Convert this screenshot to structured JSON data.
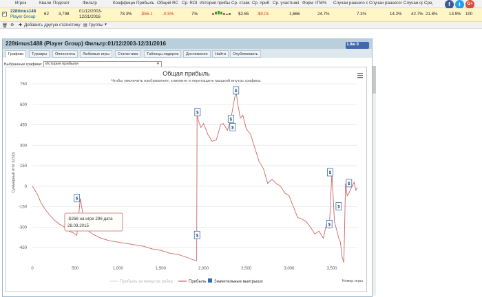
{
  "table": {
    "headers": [
      "Игрок",
      "Квали",
      "Подсчет",
      "Фильтр",
      "Коэффициен",
      "Прибыль",
      "Общий RC",
      "Ср. ROI",
      "История прибы",
      "Ср. ставк",
      "Ср. приб",
      "Ср. участникі",
      "Форм",
      "ITM%",
      "Случаи раннего с",
      "Случаи раннего/сре",
      "Случаи ср",
      "Средн"
    ],
    "row": {
      "player_name": "228timus148",
      "player_group": "Player Group",
      "qual": "62",
      "count": "3,798",
      "filter": "01/12/2003-\n12/31/2016",
      "coef": "78.3%",
      "profit": "-$55.1",
      "total_rc": "-0.5%",
      "avg_roi": "7%",
      "avg_stake": "$2.65",
      "avg_profit": "-$0.01",
      "avg_participants": "1,666",
      "itm": "24.7%",
      "early1": "7.3%",
      "early2": "14.2%",
      "avg1": "42.7%",
      "avg2": "21.8%",
      "extra1": "13.9%",
      "extra2": "100"
    }
  },
  "toolbar": {
    "add_stats": "Добавить другую статистику",
    "groups": "Группы"
  },
  "social": {
    "fb": "f",
    "tw": "t",
    "gp": "G+"
  },
  "dialog": {
    "title": "228timus1488 (Player Group) Фильтр:01/12/2003-12/31/2016",
    "like": "Like 0",
    "tabs": [
      "Графики",
      "Турниры",
      "Оппоненты",
      "Любимые игры",
      "Статистика",
      "Таблицы лидеров",
      "Достижения",
      "Найти",
      "Опубликовать"
    ],
    "graph_select_label": "Выбранные графики:",
    "graph_select_value": "История прибыли"
  },
  "chart_data": {
    "type": "line",
    "title": "Общая прибыль",
    "subtitle": "Чтобы увеличить изображение, кликните и перетащите мышкой внутрь графика.",
    "ylabel": "Суммарный итог (USD)",
    "xlabel": "Номер игры",
    "ylim": [
      -550,
      750
    ],
    "xlim": [
      0,
      3798
    ],
    "yticks": [
      750,
      600,
      450,
      300,
      150,
      0,
      -150,
      -300,
      -450
    ],
    "xticks": [
      "0",
      "500",
      "1,000",
      "1,500",
      "2,000",
      "2,500",
      "3,000",
      "3,500"
    ],
    "xtick_values": [
      0,
      500,
      1000,
      1500,
      2000,
      2500,
      3000,
      3500
    ],
    "legend": [
      "Прибыль за минусом рейка",
      "Прибыль",
      "Значительные выигрыши"
    ],
    "colors": {
      "profit": "#c96464",
      "rake_line": "#dddddd",
      "marker": "#2f6eb5"
    },
    "x": [
      0,
      60,
      100,
      150,
      200,
      260,
      320,
      380,
      430,
      470,
      520,
      560,
      620,
      700,
      800,
      900,
      1000,
      1100,
      1200,
      1300,
      1400,
      1500,
      1600,
      1700,
      1800,
      1880,
      1920,
      1925,
      1940,
      1970,
      2000,
      2050,
      2100,
      2150,
      2200,
      2230,
      2250,
      2280,
      2300,
      2320,
      2350,
      2380,
      2400,
      2430,
      2460,
      2500,
      2550,
      2600,
      2650,
      2700,
      2750,
      2800,
      2850,
      2900,
      2950,
      3000,
      3050,
      3100,
      3150,
      3200,
      3250,
      3300,
      3350,
      3400,
      3440,
      3470,
      3500,
      3510,
      3530,
      3560,
      3580,
      3600,
      3620,
      3640,
      3660,
      3680,
      3700,
      3720,
      3740,
      3760,
      3780,
      3798
    ],
    "values": [
      0,
      -60,
      -120,
      -170,
      -210,
      -250,
      -280,
      -300,
      -330,
      -340,
      -360,
      -90,
      -310,
      -350,
      -380,
      -400,
      -410,
      -420,
      -430,
      -440,
      -460,
      -470,
      -490,
      -500,
      -520,
      -540,
      -545,
      540,
      480,
      430,
      460,
      380,
      330,
      340,
      450,
      460,
      440,
      410,
      450,
      490,
      600,
      700,
      600,
      500,
      520,
      420,
      380,
      280,
      180,
      130,
      20,
      50,
      20,
      0,
      -50,
      -70,
      -150,
      -230,
      -240,
      -260,
      -300,
      -350,
      -330,
      -380,
      -270,
      -310,
      100,
      -10,
      -260,
      -330,
      -380,
      -410,
      -520,
      -560,
      20,
      -70,
      -50,
      -20,
      0,
      30,
      -30,
      -10
    ],
    "markers": [
      {
        "x": 520,
        "y": -90
      },
      {
        "x": 1925,
        "y": -360
      },
      {
        "x": 1930,
        "y": 540
      },
      {
        "x": 2320,
        "y": 490
      },
      {
        "x": 2340,
        "y": 430
      },
      {
        "x": 2380,
        "y": 700
      },
      {
        "x": 3480,
        "y": 100
      },
      {
        "x": 3470,
        "y": -280
      },
      {
        "x": 3580,
        "y": -150
      },
      {
        "x": 3700,
        "y": 20
      }
    ],
    "tooltip": {
      "line1": "-$268 на игре 296 дата",
      "line2": "28.03.2015"
    }
  }
}
